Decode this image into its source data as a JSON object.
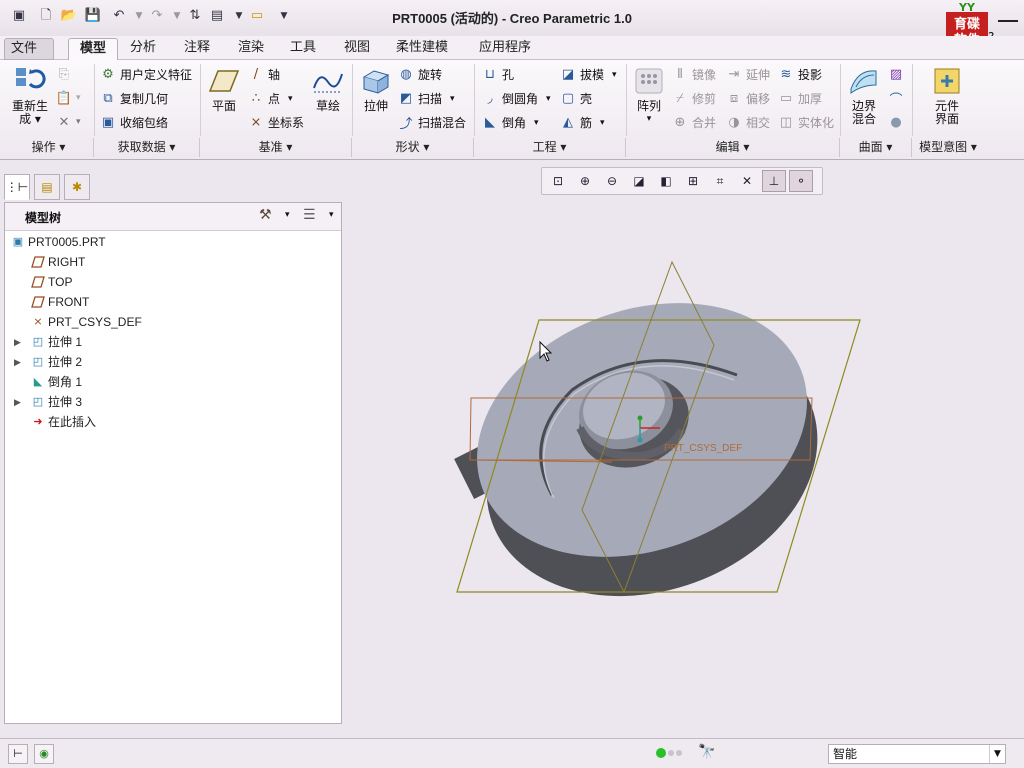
{
  "window": {
    "title": "PRT0005 (活动的) - Creo Parametric 1.0"
  },
  "logo": {
    "line1": "育碟",
    "line2": "软件",
    "leaf": "YY"
  },
  "menu_tabs": [
    "文件",
    "模型",
    "分析",
    "注释",
    "渲染",
    "工具",
    "视图",
    "柔性建模",
    "应用程序"
  ],
  "ribbon": {
    "regenerate": {
      "line1": "重新生",
      "line2": "成"
    },
    "user_feature": "用户定义特征",
    "copy_geometry": "复制几何",
    "shrinkwrap": "收缩包络",
    "plane": "平面",
    "axis": "轴",
    "point": "点",
    "csys": "坐标系",
    "sketch": "草绘",
    "extrude": "拉伸",
    "revolve": "旋转",
    "sweep": "扫描",
    "swept_blend": "扫描混合",
    "hole": "孔",
    "round": "倒圆角",
    "chamfer": "倒角",
    "draft": "拔模",
    "shell": "壳",
    "rib": "筋",
    "pattern": "阵列",
    "mirror": "镜像",
    "trim": "修剪",
    "merge": "合并",
    "extend": "延伸",
    "offset": "偏移",
    "intersect": "相交",
    "project": "投影",
    "thicken": "加厚",
    "solidify": "实体化",
    "boundary_blend": {
      "line1": "边界",
      "line2": "混合"
    },
    "component_interface": {
      "line1": "元件",
      "line2": "界面"
    },
    "groups": [
      "操作",
      "获取数据",
      "基准",
      "形状",
      "工程",
      "编辑",
      "曲面",
      "模型意图"
    ]
  },
  "model_tree": {
    "header": "模型树",
    "items": [
      {
        "label": "PRT0005.PRT",
        "icon": "part-icon",
        "expandable": false
      },
      {
        "label": "RIGHT",
        "icon": "datum-plane-icon",
        "expandable": false
      },
      {
        "label": "TOP",
        "icon": "datum-plane-icon",
        "expandable": false
      },
      {
        "label": "FRONT",
        "icon": "datum-plane-icon",
        "expandable": false
      },
      {
        "label": "PRT_CSYS_DEF",
        "icon": "csys-icon",
        "expandable": false
      },
      {
        "label": "拉伸 1",
        "icon": "extrude-icon",
        "expandable": true
      },
      {
        "label": "拉伸 2",
        "icon": "extrude-icon",
        "expandable": true
      },
      {
        "label": "倒角 1",
        "icon": "chamfer-icon",
        "expandable": false
      },
      {
        "label": "拉伸 3",
        "icon": "extrude-icon",
        "expandable": true
      },
      {
        "label": "在此插入",
        "icon": "insert-here-icon",
        "expandable": false
      }
    ]
  },
  "viewport": {
    "csys_label": "PRT_CSYS_DEF"
  },
  "status": {
    "filter_value": "智能"
  },
  "colors": {
    "part": "#a3a6b5",
    "part_side": "#55565c",
    "datum": "#8f8a1e",
    "datum_front": "#b06a3a",
    "accent_red": "#c61f1f"
  }
}
